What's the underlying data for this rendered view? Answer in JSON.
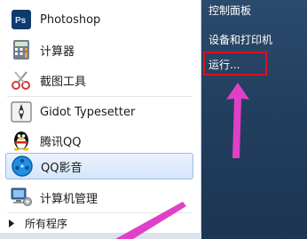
{
  "start_menu": {
    "programs": [
      {
        "label": "Photoshop",
        "icon": "photoshop-icon"
      },
      {
        "label": "计算器",
        "icon": "calculator-icon"
      },
      {
        "label": "截图工具",
        "icon": "snipping-tool-icon"
      },
      {
        "label": "Gidot Typesetter",
        "icon": "gidot-icon"
      },
      {
        "label": "腾讯QQ",
        "icon": "qq-penguin-icon"
      },
      {
        "label": "QQ影音",
        "icon": "qq-player-icon",
        "selected": true
      },
      {
        "label": "计算机管理",
        "icon": "computer-management-icon"
      }
    ],
    "all_programs_label": "所有程序",
    "right_column": [
      {
        "label": "控制面板"
      },
      {
        "label": "设备和打印机"
      },
      {
        "label": "运行..."
      }
    ]
  },
  "annotation_color": "#e0101a",
  "arrow_color": "#e040c8"
}
